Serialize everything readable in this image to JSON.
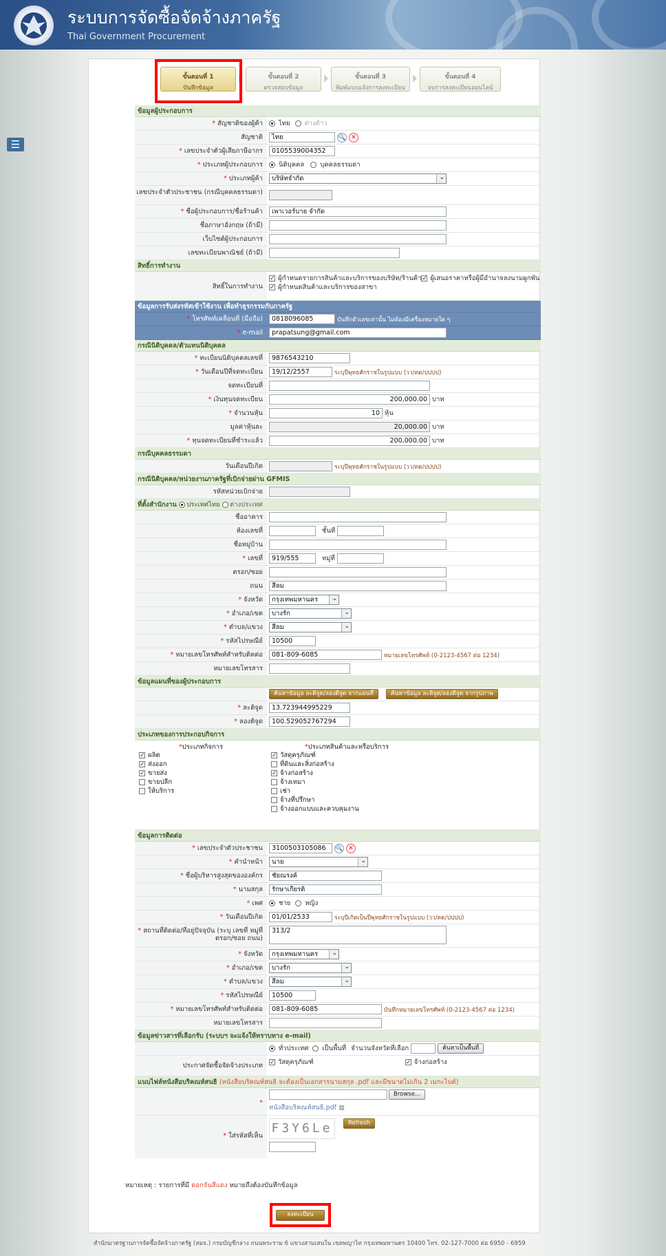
{
  "header": {
    "title": "ระบบการจัดซื้อจัดจ้างภาครัฐ",
    "subtitle": "Thai Government Procurement"
  },
  "steps": [
    {
      "num": "ขั้นตอนที่ 1",
      "label": "บันทึกข้อมูล"
    },
    {
      "num": "ขั้นตอนที่ 2",
      "label": "ตรวจสอบข้อมูล"
    },
    {
      "num": "ขั้นตอนที่ 3",
      "label": "พิมพ์แบบแจ้งการลงทะเบียน"
    },
    {
      "num": "ขั้นตอนที่ 4",
      "label": "จบการลงทะเบียนออนไลน์"
    }
  ],
  "sec1": {
    "title": "ข้อมูลผู้ประกอบการ",
    "nationality_type_label": "สัญชาติของผู้ค้า",
    "nat_thai": "ไทย",
    "nat_foreign": "ต่างด้าว",
    "nationality_label": "สัญชาติ",
    "nationality_value": "ไทย",
    "taxid_label": "เลขประจำตัวผู้เสียภาษีอากร",
    "taxid_value": "0105539004352",
    "optype_label": "ประเภทผู้ประกอบการ",
    "optype_juristic": "นิติบุคคล",
    "optype_person": "บุคคลธรรมดา",
    "vendortype_label": "ประเภทผู้ค้า",
    "vendortype_value": "บริษัทจำกัด",
    "citizenid_label": "เลขประจำตัวประชาชน (กรณีบุคคลธรรมดา)",
    "name_label": "ชื่อผู้ประกอบการ/ชื่อร้านค้า",
    "name_value": "เพาเวอร์บาย จำกัด",
    "name_en_label": "ชื่อภาษาอังกฤษ (ถ้ามี)",
    "website_label": "เว็บไซต์ผู้ประกอบการ",
    "commerce_label": "เลขทะเบียนพาณิชย์ (ถ้ามี)"
  },
  "sec2": {
    "title": "สิทธิ์การทำงาน",
    "rights_label": "สิทธิ์ในการทำงาน",
    "rights": [
      "ผู้กำหนดรายการสินค้าและบริการของบริษัท/ร้านค้า",
      "ผู้กำหนดสินค้าและบริการของสาขา",
      "ผู้เสนอราคาหรือผู้มีอำนาจลงนามผูกพัน"
    ]
  },
  "sec3": {
    "title": "ข้อมูลการรับส่งรหัสเข้าใช้งาน เพื่อทำธุรกรรมกับภาครัฐ",
    "mobile_label": "โทรศัพท์เคลื่อนที่ (มือถือ)",
    "mobile_value": "0818096085",
    "mobile_hint": "บันทึกตัวเลขเท่านั้น ไม่ต้องมีเครื่องหมายใด ๆ",
    "email_label": "e-mail",
    "email_value": "prapatsung@gmail.com"
  },
  "sec4": {
    "title": "กรณีนิติบุคคล/ตัวแทนนิติบุคคล",
    "regno_label": "ทะเบียนนิติบุคคลเลขที่",
    "regno_value": "9876543210",
    "regdate_label": "วันเดือนปีที่จดทะเบียน",
    "regdate_value": "19/12/2557",
    "regdate_hint": "ระบุปีพุทธศักราชในรูปแบบ (วว/ดด/ปปปป)",
    "regat_label": "จดทะเบียนที่",
    "capital_label": "เงินทุนจดทะเบียน",
    "capital_value": "200,000.00",
    "baht": "บาท",
    "shares_label": "จำนวนหุ้น",
    "shares_value": "10",
    "share_unit": "หุ้น",
    "shareval_label": "มูลค่าหุ้นละ",
    "shareval_value": "20,000.00",
    "paid_label": "ทุนจดทะเบียนที่ชำระแล้ว",
    "paid_value": "200,000.00"
  },
  "sec5": {
    "title": "กรณีบุคคลธรรมดา",
    "birth_label": "วันเดือนปีเกิด",
    "birth_hint": "ระบุปีพุทธศักราชในรูปแบบ (วว/ดด/ปปปป)"
  },
  "sec6": {
    "title": "กรณีนิติบุคคล/หน่วยงานภาครัฐที่เบิกจ่ายผ่าน GFMIS",
    "code_label": "รหัสหน่วยเบิกจ่าย"
  },
  "sec7": {
    "title": "ที่ตั้งสำนักงาน",
    "opt_th": "ประเทศไทย",
    "opt_foreign": "ต่างประเทศ",
    "building_label": "ชื่ออาคาร",
    "room_label": "ห้องเลขที่",
    "floor_label": "ชั้นที่",
    "village_label": "ชื่อหมู่บ้าน",
    "no_label": "เลขที่",
    "no_value": "919/555",
    "moo_label": "หมู่ที่",
    "soi_label": "ตรอก/ซอย",
    "road_label": "ถนน",
    "road_value": "สีลม",
    "province_label": "จังหวัด",
    "province_value": "กรุงเทพมหานคร",
    "district_label": "อำเภอ/เขต",
    "district_value": "บางรัก",
    "subdistrict_label": "ตำบล/แขวง",
    "subdistrict_value": "สีลม",
    "zip_label": "รหัสไปรษณีย์",
    "zip_value": "10500",
    "phone_label": "หมายเลขโทรศัพท์สำหรับติดต่อ",
    "phone_value": "081-809-6085",
    "phone_hint": "หมายเลขโทรศัพท์ (0-2123-4567 ต่อ 1234)",
    "fax_label": "หมายเลขโทรสาร"
  },
  "sec8": {
    "title": "ข้อมูลแผนที่ของผู้ประกอบการ",
    "btn_map": "ค้นหาข้อมูล ละติจูด/ลองติจูด จากแผนที่",
    "btn_img": "ค้นหาข้อมูล ละติจูด/ลองติจูด จากรูปภาพ",
    "lat_label": "ละติจูด",
    "lat_value": "13.723944995229",
    "lng_label": "ลองติจูด",
    "lng_value": "100.529052767294"
  },
  "sec9": {
    "title": "ประเภทของการประกอบกิจการ",
    "biz_head": "ประเภทกิจการ",
    "prod_head": "ประเภทสินค้าและหรือบริการ",
    "biz": [
      {
        "label": "ผลิต",
        "checked": true
      },
      {
        "label": "ส่งออก",
        "checked": true
      },
      {
        "label": "ขายส่ง",
        "checked": true
      },
      {
        "label": "ขายปลีก",
        "checked": false
      },
      {
        "label": "ให้บริการ",
        "checked": false
      }
    ],
    "prod": [
      {
        "label": "วัสดุครุภัณฑ์",
        "checked": true
      },
      {
        "label": "ที่ดินและสิ่งก่อสร้าง",
        "checked": false
      },
      {
        "label": "จ้างก่อสร้าง",
        "checked": true
      },
      {
        "label": "จ้างเหมา",
        "checked": false
      },
      {
        "label": "เช่า",
        "checked": false
      },
      {
        "label": "จ้างที่ปรึกษา",
        "checked": false
      },
      {
        "label": "จ้างออกแบบและควบคุมงาน",
        "checked": false
      }
    ]
  },
  "sec10": {
    "title": "ข้อมูลการติดต่อ",
    "cid_label": "เลขประจำตัวประชาชน",
    "cid_value": "3100503105086",
    "prefix_label": "คำนำหน้า",
    "prefix_value": "นาย",
    "fname_label": "ชื่อผู้บริหารสูงสุดขององค์กร",
    "fname_value": "ชัยณรงค์",
    "lname_label": "นามสกุล",
    "lname_value": "รักษาเกียรติ",
    "gender_label": "เพศ",
    "male": "ชาย",
    "female": "หญิง",
    "dob_label": "วันเดือนปีเกิด",
    "dob_value": "01/01/2533",
    "dob_hint": "ระบุปีเกิดเป็นปีพุทธศักราชในรูปแบบ (วว/ดด/ปปปป)",
    "addr_label": "สถานที่ติดต่อ/ที่อยู่ปัจจุบัน (ระบุ เลขที่ หมู่ที่ ตรอก/ซอย ถนน)",
    "addr_value": "313/2",
    "province_label": "จังหวัด",
    "province_value": "กรุงเทพมหานคร",
    "district_label": "อำเภอ/เขต",
    "district_value": "บางรัก",
    "subdistrict_label": "ตำบล/แขวง",
    "subdistrict_value": "สีลม",
    "zip_label": "รหัสไปรษณีย์",
    "zip_value": "10500",
    "phone_label": "หมายเลขโทรศัพท์สำหรับติดต่อ",
    "phone_value": "081-809-6085",
    "phone_hint": "บันทึกหมายเลขโทรศัพท์ (0-2123-4567 ต่อ 1234)",
    "fax_label": "หมายเลขโทรสาร"
  },
  "sec11": {
    "title": "ข้อมูลข่าวสารที่เลือกรับ (ระบบฯ จะแจ้งให้ทราบทาง e-mail)",
    "opt_all": "ทั่วประเทศ",
    "opt_area": "เป็นพื้นที่",
    "count_label": "จำนวนจังหวัดที่เลือก",
    "btn_area": "ค้นหาเป็นพื้นที่",
    "announce_label": "ประกาศจัดซื้อจัดจ้างประเภท",
    "announce": [
      "วัสดุครุภัณฑ์",
      "จ้างก่อสร้าง"
    ]
  },
  "sec12": {
    "title": "แนบไฟล์หนังสือบริคณห์สนธิ",
    "title_note": "(หนังสือบริคณห์สนธิ จะต้องเป็นเอกสารนามสกุล .pdf และมีขนาดไม่เกิน 2 เมกะไบต์)",
    "browse": "Browse...",
    "file_name": "หนังสือบริคณห์สนธิ.pdf",
    "captcha_label": "ใส่รหัสที่เห็น",
    "captcha": "F3Y6Le",
    "refresh": "Refresh"
  },
  "note": {
    "prefix": "หมายเหตุ : รายการที่มี",
    "red": "ดอกจันสีแดง",
    "suffix": "หมายถึงต้องบันทึกข้อมูล"
  },
  "submit": "ลงทะเบียน",
  "footer": "สำนักมาตรฐานการจัดซื้อจัดจ้างภาครัฐ (สมจ.) กรมบัญชีกลาง ถนนพระราม 6 แขวงสามเสนใน เขตพญาไท กรุงเทพมหานคร 10400 โทร. 02-127-7000 ต่อ 6950 - 6959"
}
